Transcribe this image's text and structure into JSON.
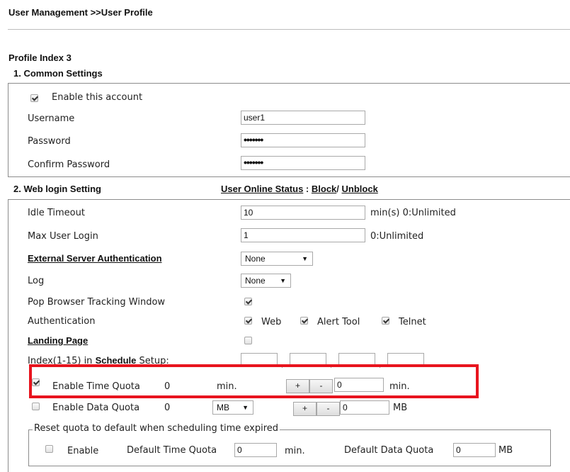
{
  "breadcrumb": "User Management >>User Profile",
  "profile_index": "Profile Index 3",
  "common": {
    "title": "1. Common Settings",
    "enable_label": "Enable this account",
    "enable_checked": true,
    "username_label": "Username",
    "username_value": "user1",
    "password_label": "Password",
    "password_mask": "•••••••",
    "confirm_label": "Confirm Password",
    "confirm_mask": "•••••••"
  },
  "web": {
    "title": "2. Web login Setting",
    "status_link": "User Online Status",
    "status_sep": " : ",
    "block_link": "Block",
    "slash": "/ ",
    "unblock_link": "Unblock",
    "idle_label": "Idle Timeout",
    "idle_value": "10",
    "idle_note": "min(s) 0:Unlimited",
    "max_label": "Max User Login",
    "max_value": "1",
    "max_note": "0:Unlimited",
    "ext_label": "External Server Authentication",
    "ext_value": "None",
    "log_label": "Log",
    "log_value": "None",
    "pop_label": "Pop Browser Tracking Window",
    "pop_checked": true,
    "auth_label": "Authentication",
    "auth_web": "Web",
    "auth_alert": "Alert Tool",
    "auth_telnet": "Telnet",
    "landing_label": "Landing Page",
    "landing_checked": false,
    "schedule_prefix": "Index(1-15) in ",
    "schedule_link": "Schedule",
    "schedule_suffix": " Setup:",
    "schedule_values": [
      "",
      "",
      "",
      ""
    ],
    "schedule_sep": ",",
    "time_quota": {
      "label": "Enable Time Quota",
      "checked": true,
      "value": "0",
      "unit": "min.",
      "plus": "+",
      "minus": "-",
      "input": "0",
      "input_unit": "min."
    },
    "data_quota": {
      "label": "Enable Data Quota",
      "checked": false,
      "value": "0",
      "unit_select": "MB",
      "plus": "+",
      "minus": "-",
      "input": "0",
      "input_unit": "MB"
    },
    "reset": {
      "legend": "Reset quota to default when scheduling time expired",
      "enable_label": "Enable",
      "enable_checked": false,
      "time_label": "Default Time Quota",
      "time_value": "0",
      "time_unit": "min.",
      "data_label": "Default Data Quota",
      "data_value": "0",
      "data_unit": "MB"
    }
  },
  "colors": {
    "highlight": "#e8141e",
    "border": "#8c8c8c"
  }
}
